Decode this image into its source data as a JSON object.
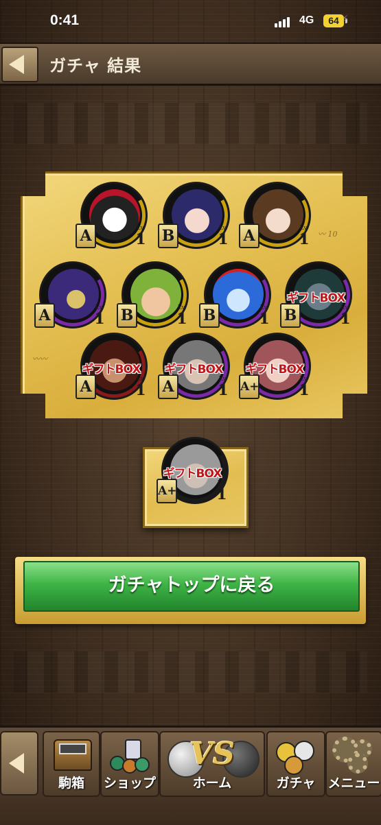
{
  "status_bar": {
    "time": "0:41",
    "network": "4G",
    "battery": "64"
  },
  "header": {
    "title": "ガチャ 結果"
  },
  "results": [
    {
      "rank": "A",
      "level_label": "Lv.",
      "level": "1",
      "gift_box": false,
      "ring_color": "#c9a010",
      "portrait": "penguin-top-hat"
    },
    {
      "rank": "B",
      "level_label": "Lv.",
      "level": "1",
      "gift_box": false,
      "ring_color": "#c9a010",
      "portrait": "dark-haired-girl"
    },
    {
      "rank": "A",
      "level_label": "Lv.",
      "level": "1",
      "gift_box": false,
      "ring_color": "#c9a010",
      "portrait": "horned-girl"
    },
    {
      "rank": "A",
      "level_label": "Lv.",
      "level": "1",
      "gift_box": false,
      "ring_color": "#7a2aa8",
      "portrait": "masked-man"
    },
    {
      "rank": "B",
      "level_label": "Lv.",
      "level": "1",
      "gift_box": false,
      "ring_color": "#c9a010",
      "portrait": "elf-creature"
    },
    {
      "rank": "B",
      "level_label": "Lv.",
      "level": "1",
      "gift_box": false,
      "ring_color": "#7a2aa8",
      "portrait": "blue-frog"
    },
    {
      "rank": "B",
      "level_label": "Lv.",
      "level": "1",
      "gift_box": true,
      "gift_label": "ギフトBOX",
      "ring_color": "#7a2aa8",
      "portrait": "winged-beast"
    },
    {
      "rank": "A",
      "level_label": "Lv.",
      "level": "1",
      "gift_box": true,
      "gift_label": "ギフトBOX",
      "ring_color": "#8a1a1a",
      "portrait": "horned-demon"
    },
    {
      "rank": "A",
      "level_label": "Lv.",
      "level": "1",
      "gift_box": true,
      "gift_label": "ギフトBOX",
      "ring_color": "#7a2aa8",
      "portrait": "grey-hair-man"
    },
    {
      "rank": "A+",
      "level_label": "Lv.",
      "level": "1",
      "gift_box": true,
      "gift_label": "ギフトBOX",
      "ring_color": "#7a2aa8",
      "portrait": "pink-hair-girl"
    },
    {
      "rank": "A+",
      "level_label": "Lv.",
      "level": "1",
      "gift_box": true,
      "gift_label": "ギフトBOX",
      "ring_color": "#1a1a1a",
      "portrait": "silver-hair-demon"
    }
  ],
  "actions": {
    "return_label": "ガチャトップに戻る"
  },
  "nav": {
    "items": [
      {
        "label": "駒箱",
        "icon": "chest-icon"
      },
      {
        "label": "ショップ",
        "icon": "coins-icon"
      },
      {
        "label": "ホーム",
        "icon": "vs-icon"
      },
      {
        "label": "ガチャ",
        "icon": "gacha-coins-icon"
      },
      {
        "label": "メニュー",
        "icon": "gear-icon"
      }
    ]
  }
}
